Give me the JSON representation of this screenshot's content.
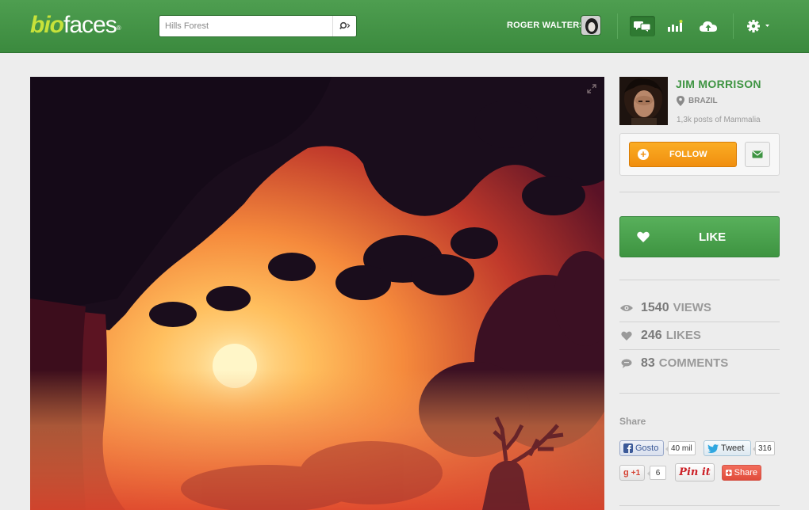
{
  "brand": {
    "part1": "bio",
    "part2": "faces",
    "mark": "®"
  },
  "search": {
    "value": "Hills Forest"
  },
  "user": {
    "name": "ROGER WALTERS"
  },
  "profile": {
    "name": "JIM MORRISON",
    "location": "BRAZIL",
    "posts": "1,3k posts of Mammalia",
    "follow_label": "FOLLOW"
  },
  "like": {
    "label": "LIKE"
  },
  "stats": {
    "views": {
      "value": "1540",
      "label": "VIEWS"
    },
    "likes": {
      "value": "246",
      "label": "LIKES"
    },
    "comments": {
      "value": "83",
      "label": "COMMENTS"
    }
  },
  "share": {
    "label": "Share",
    "facebook": {
      "label": "Gosto",
      "count": "40 mil"
    },
    "twitter": {
      "label": "Tweet",
      "count": "316"
    },
    "gplus": {
      "label": "+1",
      "count": "6"
    },
    "pinterest": {
      "label": "Pin it"
    },
    "addthis": {
      "label": "Share"
    }
  },
  "colors": {
    "header_green": "#4e9e50",
    "accent_green": "#3e9442",
    "follow_orange": "#f59c18",
    "logo_lime": "#c7e23a"
  },
  "icons": [
    "search-icon",
    "messages-icon",
    "stats-icon",
    "upload-cloud-icon",
    "settings-gear-icon",
    "expand-icon",
    "location-pin-icon",
    "envelope-icon",
    "heart-icon",
    "eye-icon",
    "comment-icon"
  ]
}
